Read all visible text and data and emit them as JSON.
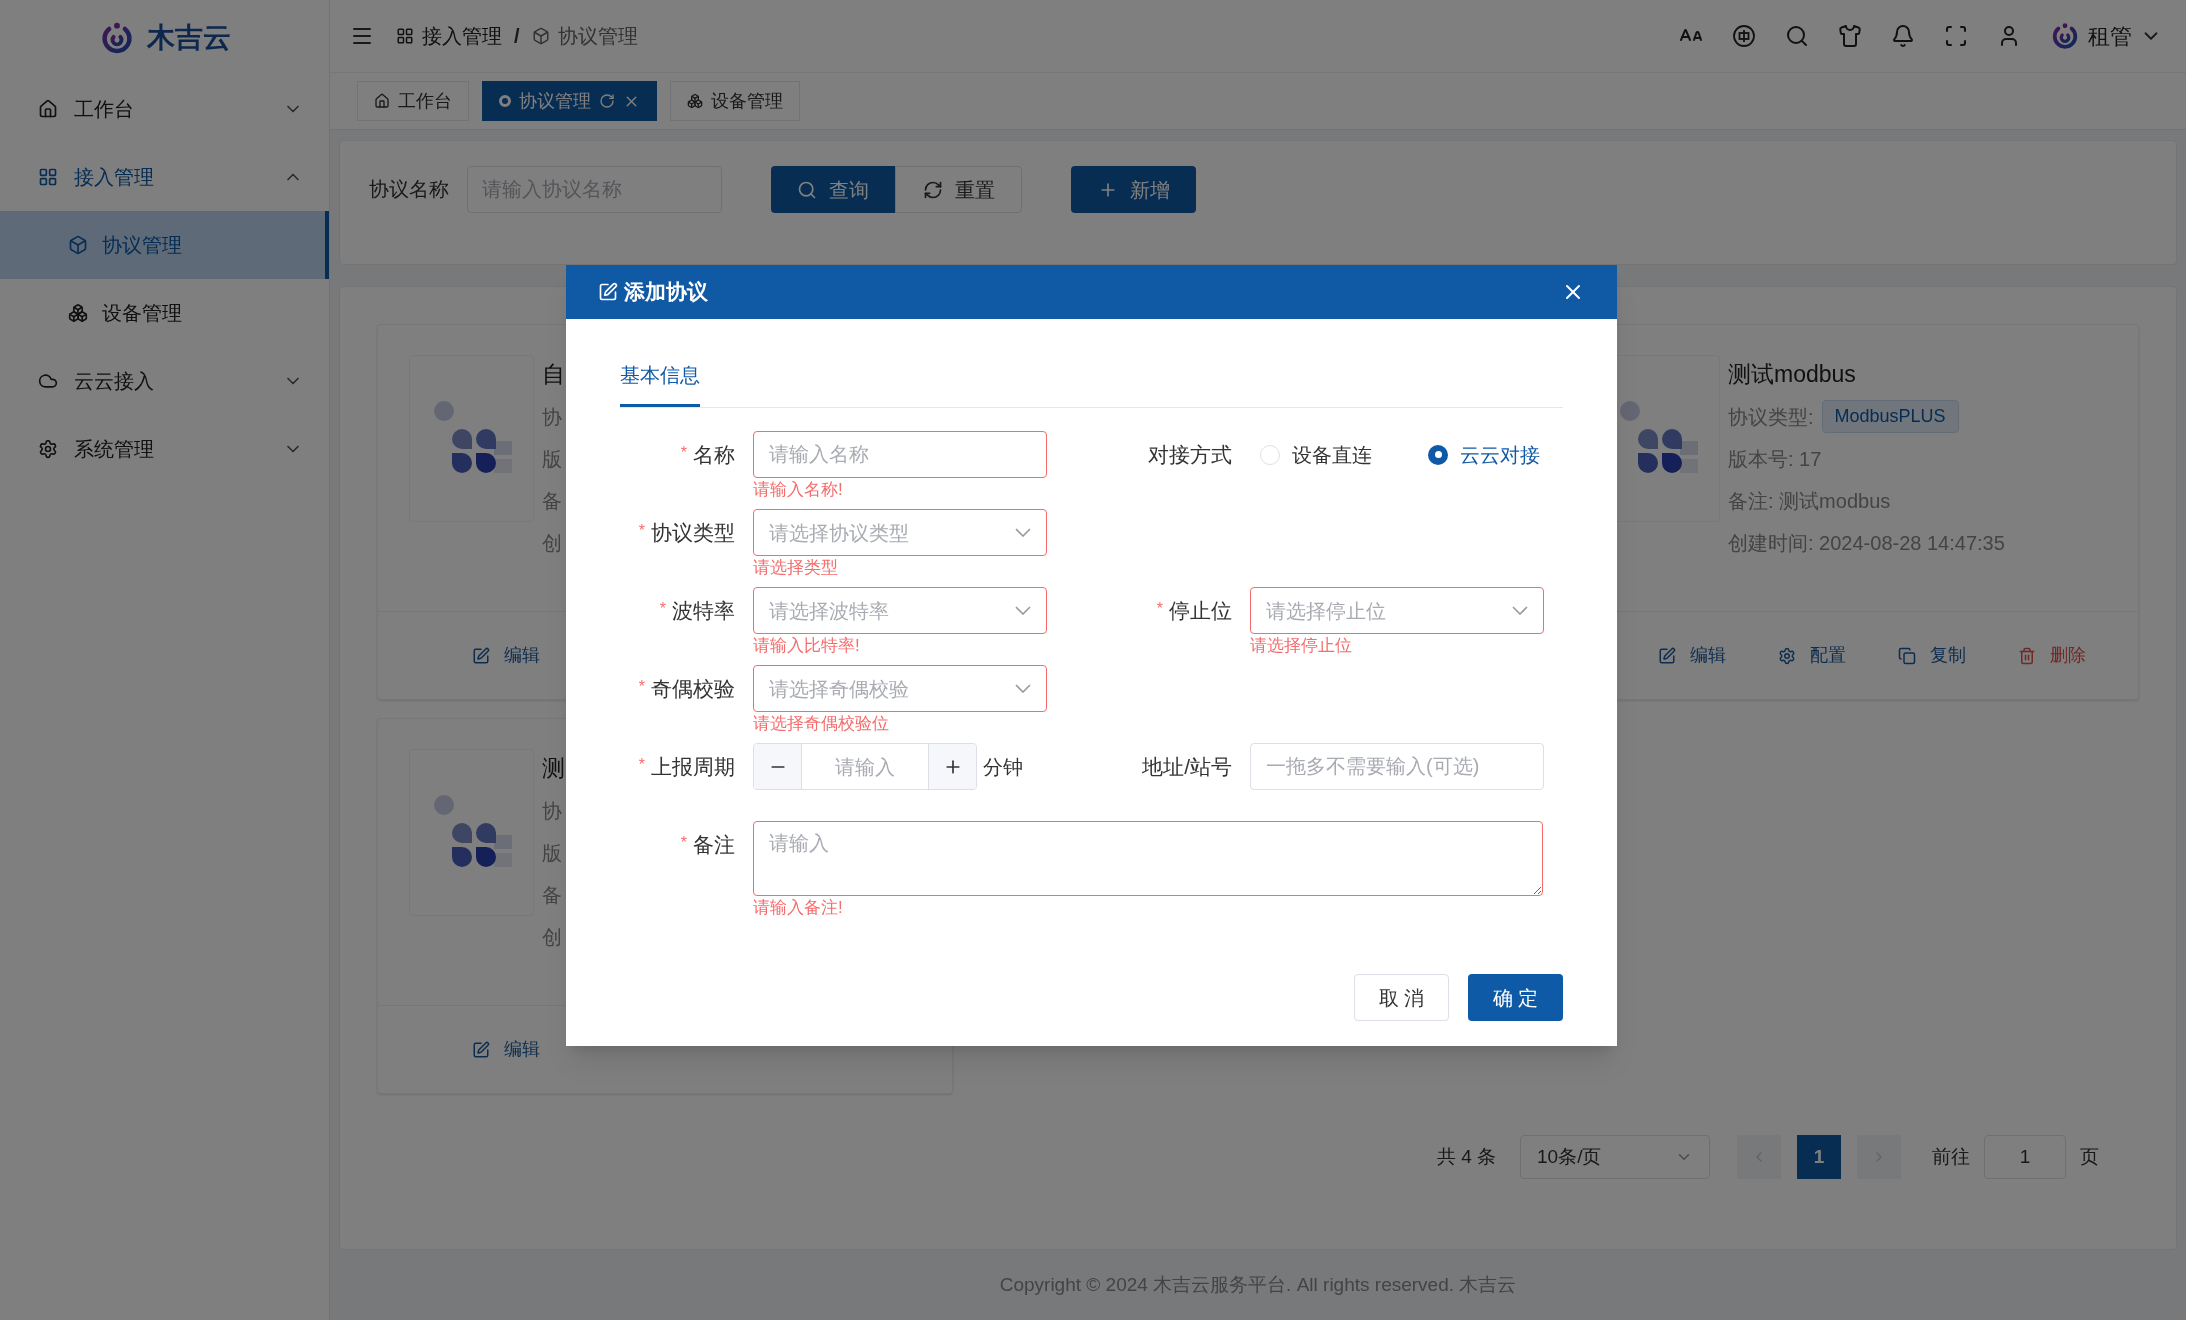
{
  "sidebar": {
    "logo_text": "木吉云",
    "items": [
      {
        "label": "工作台",
        "expanded": false,
        "selected": false
      },
      {
        "label": "接入管理",
        "expanded": true,
        "selected": false,
        "children": [
          {
            "label": "协议管理",
            "selected": true
          },
          {
            "label": "设备管理",
            "selected": false
          }
        ]
      },
      {
        "label": "云云接入",
        "expanded": false,
        "selected": false
      },
      {
        "label": "系统管理",
        "expanded": false,
        "selected": false
      }
    ]
  },
  "header": {
    "breadcrumb": [
      "接入管理",
      "协议管理"
    ],
    "separator": "/",
    "user": "租管"
  },
  "tabs": [
    {
      "label": "工作台",
      "selected": false
    },
    {
      "label": "协议管理",
      "selected": true
    },
    {
      "label": "设备管理",
      "selected": false
    }
  ],
  "search": {
    "label": "协议名称",
    "placeholder": "请输入协议名称",
    "buttons": [
      {
        "kind": "search",
        "label": "查询"
      },
      {
        "kind": "reset",
        "label": "重置"
      },
      {
        "kind": "add",
        "label": "新增"
      }
    ]
  },
  "cards": [
    {
      "title": "自",
      "fields": [
        {
          "text": "协"
        },
        {
          "text": "版"
        },
        {
          "text": "备"
        },
        {
          "text": "创"
        }
      ],
      "actions": [
        {
          "kind": "edit",
          "label": "编辑"
        }
      ]
    },
    {
      "title": "测试modbus",
      "fields": [
        {
          "text": "协议类型:",
          "tag": "ModbusPLUS"
        },
        {
          "text": "版本号: 17"
        },
        {
          "text": "备注: 测试modbus"
        },
        {
          "text": "创建时间: 2024-08-28 14:47:35"
        }
      ],
      "actions": [
        {
          "kind": "edit",
          "label": "编辑"
        },
        {
          "kind": "config",
          "label": "配置"
        },
        {
          "kind": "copy",
          "label": "复制"
        },
        {
          "kind": "delete",
          "label": "删除"
        }
      ]
    },
    {
      "title": "测",
      "fields": [
        {
          "text": "协"
        },
        {
          "text": "版"
        },
        {
          "text": "备"
        },
        {
          "text": "创"
        }
      ],
      "actions": [
        {
          "kind": "edit",
          "label": "编辑"
        }
      ]
    }
  ],
  "pagination": {
    "total": "共 4 条",
    "page_size": "10条/页",
    "pages": [
      {
        "label": "1",
        "selected": true
      }
    ],
    "goto_label": "前往",
    "goto_value": "1",
    "goto_suffix": "页"
  },
  "footer": "Copyright © 2024 木吉云服务平台. All rights reserved. 木吉云",
  "dialog": {
    "title": "添加协议",
    "tabs": [
      {
        "label": "基本信息",
        "selected": true
      }
    ],
    "rows": [
      [
        {
          "kind": "input",
          "label": "名称",
          "required_mark": "*",
          "placeholder": "请输入名称",
          "error": "请输入名称!"
        },
        {
          "kind": "radio",
          "label": "对接方式",
          "options": [
            {
              "label": "设备直连",
              "selected": false
            },
            {
              "label": "云云对接",
              "selected": true
            }
          ]
        }
      ],
      [
        {
          "kind": "select",
          "label": "协议类型",
          "required_mark": "*",
          "placeholder": "请选择协议类型",
          "error": "请选择类型"
        }
      ],
      [
        {
          "kind": "select",
          "label": "波特率",
          "required_mark": "*",
          "placeholder": "请选择波特率",
          "error": "请输入比特率!"
        },
        {
          "kind": "select",
          "label": "停止位",
          "required_mark": "*",
          "placeholder": "请选择停止位",
          "error": "请选择停止位"
        }
      ],
      [
        {
          "kind": "select",
          "label": "奇偶校验",
          "required_mark": "*",
          "placeholder": "请选择奇偶校验",
          "error": "请选择奇偶校验位"
        }
      ],
      [
        {
          "kind": "stepper",
          "label": "上报周期",
          "required_mark": "*",
          "placeholder": "请输入",
          "suffix": "分钟"
        },
        {
          "kind": "input",
          "label": "地址/站号",
          "placeholder": "一拖多不需要输入(可选)"
        }
      ],
      [
        {
          "kind": "textarea",
          "label": "备注",
          "required_mark": "*",
          "placeholder": "请输入",
          "error": "请输入备注!"
        }
      ]
    ],
    "buttons": [
      {
        "kind": "default",
        "label": "取 消"
      },
      {
        "kind": "primary",
        "label": "确 定"
      }
    ]
  }
}
